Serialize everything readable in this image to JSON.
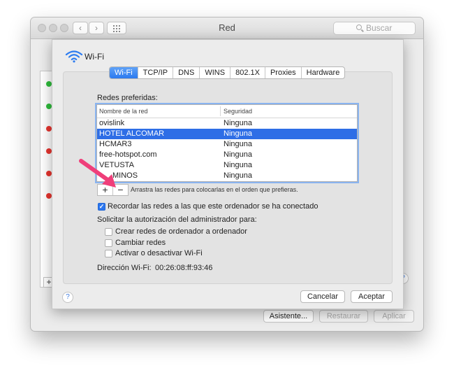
{
  "window": {
    "title": "Red",
    "search_placeholder": "Buscar",
    "nav_back": "‹",
    "nav_forward": "›",
    "add_service": "+",
    "buttons": {
      "assistant": "Asistente...",
      "restore": "Restaurar",
      "apply": "Aplicar"
    },
    "help": "?"
  },
  "sheet": {
    "header_label": "Wi-Fi",
    "tabs": [
      "Wi-Fi",
      "TCP/IP",
      "DNS",
      "WINS",
      "802.1X",
      "Proxies",
      "Hardware"
    ],
    "selected_tab": "Wi-Fi",
    "preferred_networks_label": "Redes preferidas:",
    "table": {
      "columns": [
        "Nombre de la red",
        "Seguridad"
      ],
      "rows": [
        {
          "name": "ovislink",
          "security": "Ninguna"
        },
        {
          "name": "HOTEL ALCOMAR",
          "security": "Ninguna",
          "selected": true
        },
        {
          "name": "HCMAR3",
          "security": "Ninguna"
        },
        {
          "name": "free-hotspot.com",
          "security": "Ninguna"
        },
        {
          "name": "VETUSTA",
          "security": "Ninguna"
        },
        {
          "name": "MINOS",
          "security": "Ninguna"
        }
      ]
    },
    "plus_label": "+",
    "minus_label": "−",
    "drag_hint": "Arrastra las redes para colocarlas en el orden que prefieras.",
    "remember_networks": {
      "label": "Recordar las redes a las que este ordenador se ha conectado",
      "checked": true
    },
    "admin_auth_label": "Solicitar la autorización del administrador para:",
    "admin_options": [
      {
        "label": "Crear redes de ordenador a ordenador",
        "checked": false
      },
      {
        "label": "Cambiar redes",
        "checked": false
      },
      {
        "label": "Activar o desactivar Wi-Fi",
        "checked": false
      }
    ],
    "wifi_address_label": "Dirección Wi-Fi:",
    "wifi_address_value": "00:26:08:ff:93:46",
    "help": "?",
    "cancel_label": "Cancelar",
    "accept_label": "Aceptar"
  },
  "colors": {
    "accent": "#2e6ee6",
    "status_green": "#2fbd3c",
    "status_red": "#e8352f",
    "annotation_arrow": "#ef3f7a"
  },
  "icons": {
    "wifi": "wifi-icon",
    "search": "magnifier-icon",
    "arrow": "annotation-arrow-icon"
  }
}
